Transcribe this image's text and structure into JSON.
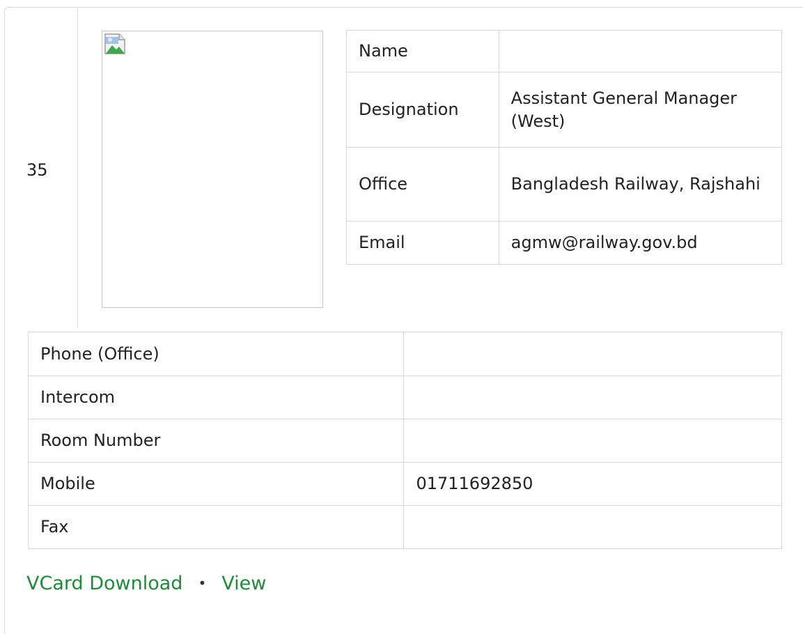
{
  "entry": {
    "serial": "35"
  },
  "info_table": [
    {
      "label": "Name",
      "value": ""
    },
    {
      "label": "Designation",
      "value": "Assistant General Manager (West)"
    },
    {
      "label": "Office",
      "value": "Bangladesh Railway, Rajshahi"
    },
    {
      "label": "Email",
      "value": "agmw@railway.gov.bd"
    }
  ],
  "contact_table": [
    {
      "label": "Phone (Office)",
      "value": ""
    },
    {
      "label": "Intercom",
      "value": ""
    },
    {
      "label": "Room Number",
      "value": ""
    },
    {
      "label": "Mobile",
      "value": "01711692850"
    },
    {
      "label": "Fax",
      "value": ""
    }
  ],
  "links": {
    "vcard_label": "VCard Download",
    "separator": "•",
    "view_label": "View"
  },
  "colors": {
    "link": "#1f8b3a",
    "border": "#d7d7d7"
  },
  "icons": {
    "photo_placeholder": "broken-image-icon"
  }
}
